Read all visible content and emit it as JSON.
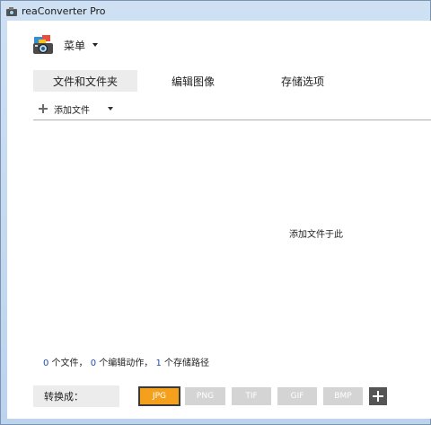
{
  "window": {
    "title": "reaConverter Pro"
  },
  "menu": {
    "label": "菜单"
  },
  "tabs": [
    {
      "label": "文件和文件夹",
      "active": true
    },
    {
      "label": "编辑图像",
      "active": false
    },
    {
      "label": "存储选项",
      "active": false
    }
  ],
  "add_files": {
    "label": "添加文件"
  },
  "drop_area": {
    "hint": "添加文件于此"
  },
  "status": {
    "files_count": "0",
    "files_text": " 个文件，",
    "edit_count": "0",
    "edit_text": " 个编辑动作，",
    "path_count": "1",
    "path_text": " 个存储路径"
  },
  "convert": {
    "label": "转换成：",
    "formats": [
      {
        "label": "JPG",
        "selected": true,
        "color": "#f5a01d"
      },
      {
        "label": "PNG",
        "selected": false,
        "color": "#d4d4d4"
      },
      {
        "label": "TIF",
        "selected": false,
        "color": "#d4d4d4"
      },
      {
        "label": "GIF",
        "selected": false,
        "color": "#d4d4d4"
      },
      {
        "label": "BMP",
        "selected": false,
        "color": "#d4d4d4"
      }
    ]
  },
  "icons": {
    "app": "camera-icon",
    "menu": "camera-logo-icon",
    "add": "plus-icon",
    "add_format": "plus-square-icon"
  }
}
